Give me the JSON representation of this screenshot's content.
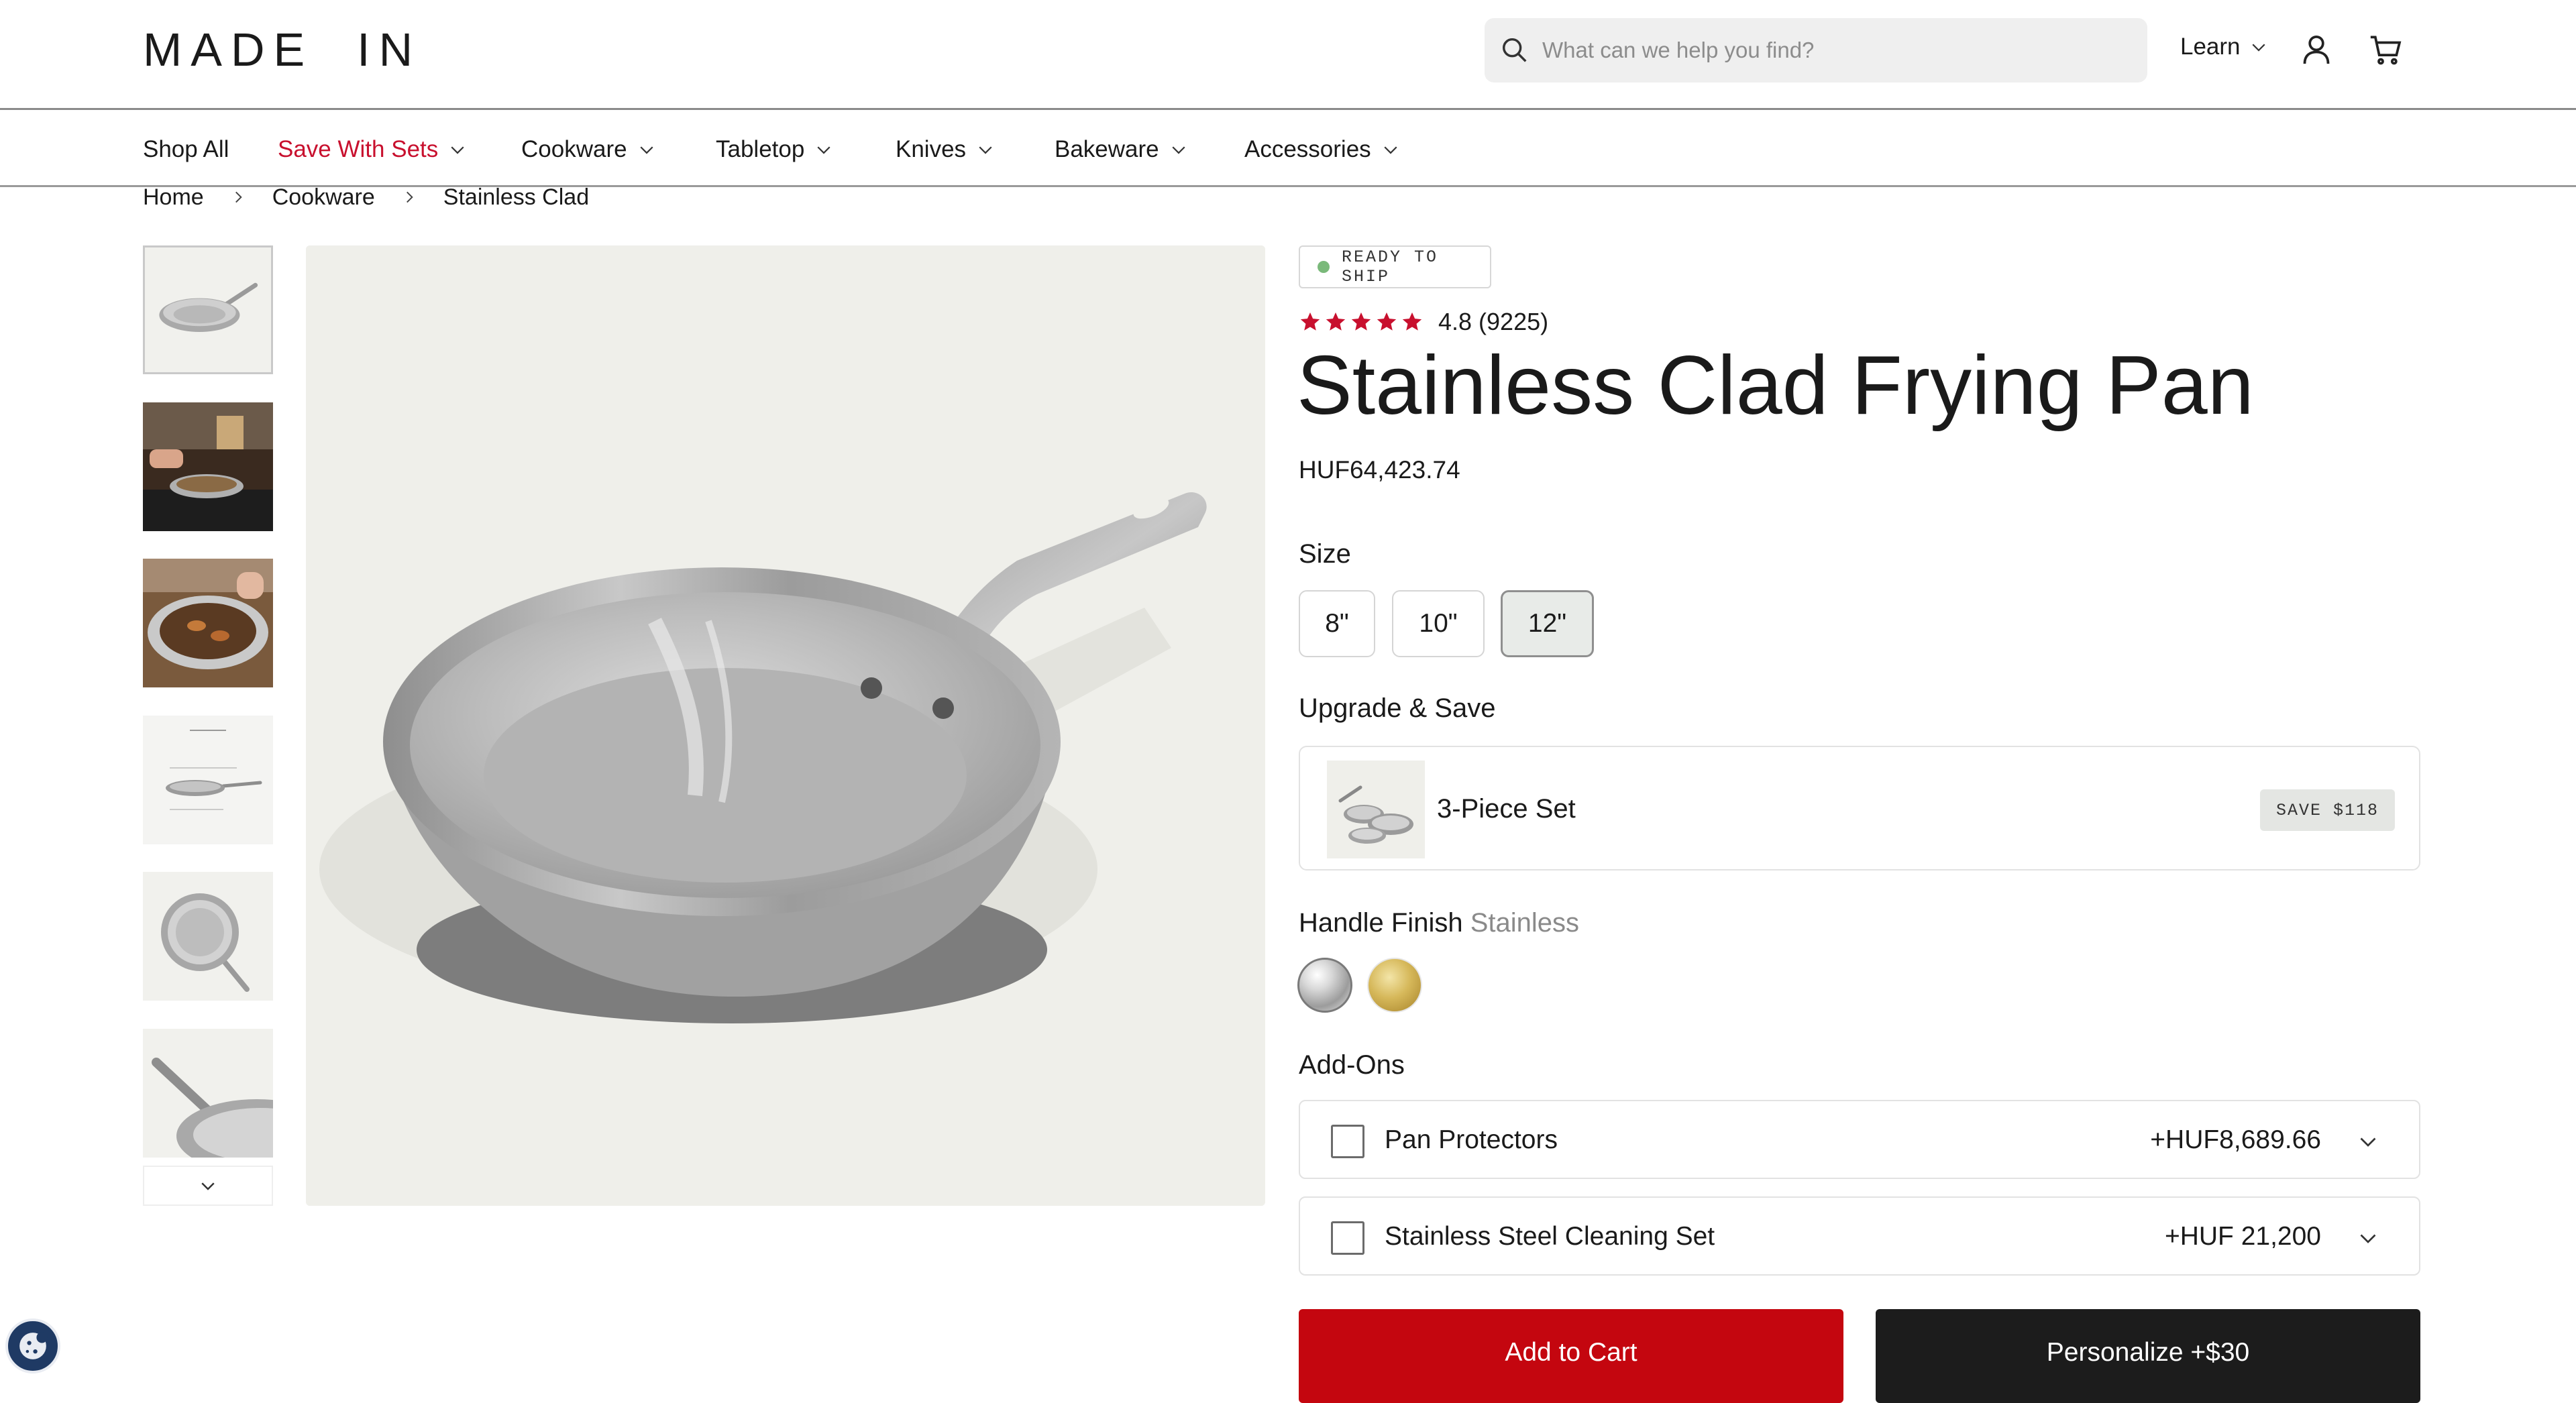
{
  "header": {
    "logo": "MADE  IN",
    "search_placeholder": "What can we help you find?",
    "learn_label": "Learn",
    "icons": [
      "search-icon",
      "account-icon",
      "cart-icon",
      "chevron-down-icon"
    ]
  },
  "nav": {
    "items": [
      {
        "label": "Shop All"
      },
      {
        "label": "Save With Sets",
        "color": "#c8102e"
      },
      {
        "label": "Cookware"
      },
      {
        "label": "Tabletop"
      },
      {
        "label": "Knives"
      },
      {
        "label": "Bakeware"
      },
      {
        "label": "Accessories"
      }
    ]
  },
  "breadcrumb": [
    "Home",
    "Cookware",
    "Stainless Clad"
  ],
  "product": {
    "badge": "READY TO SHIP",
    "rating": "4.8",
    "reviews": "(9225)",
    "stars": 5,
    "star_color": "#c8102e",
    "title": "Stainless Clad Frying Pan",
    "price": "HUF64,423.74",
    "size_label": "Size",
    "sizes": [
      "8\"",
      "10\"",
      "12\""
    ],
    "selected_size": "12\"",
    "upgrade_label": "Upgrade & Save",
    "upgrade": {
      "name": "3-Piece Set",
      "badge": "SAVE $118"
    },
    "finish_label": "Handle Finish",
    "finish_value": "Stainless",
    "finishes": [
      "stainless",
      "gold"
    ],
    "addons_label": "Add-Ons",
    "addons": [
      {
        "label": "Pan Protectors",
        "price": "+HUF8,689.66"
      },
      {
        "label": "Stainless Steel Cleaning Set",
        "price": "+HUF 21,200"
      }
    ],
    "add_to_cart": "Add to Cart",
    "personalize": "Personalize +$30",
    "accent": "#c4060f"
  }
}
